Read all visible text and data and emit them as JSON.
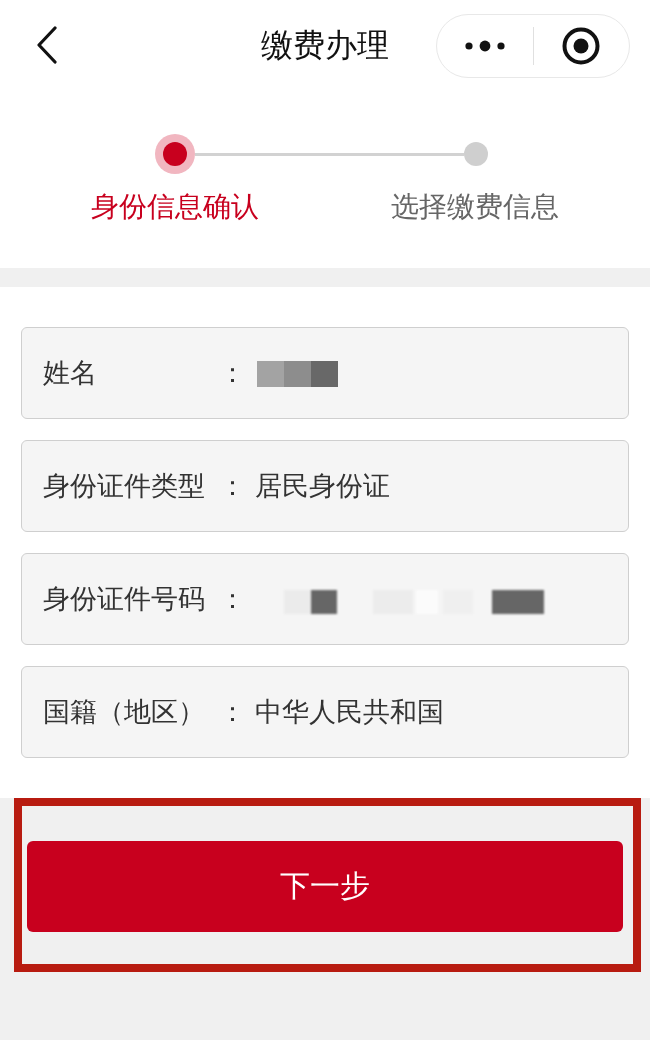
{
  "header": {
    "title": "缴费办理"
  },
  "steps": [
    {
      "label": "身份信息确认",
      "selected": true
    },
    {
      "label": "选择缴费信息",
      "selected": false
    }
  ],
  "fields": [
    {
      "label": "姓名",
      "separator": "：",
      "kind": "pixelated"
    },
    {
      "label": "身份证件类型",
      "separator": "：",
      "kind": "text",
      "value": "居民身份证"
    },
    {
      "label": "身份证件号码",
      "separator": "：",
      "kind": "blurred"
    },
    {
      "label": "国籍（地区）",
      "separator": "：",
      "kind": "text",
      "value": "中华人民共和国"
    }
  ],
  "footer": {
    "button": "下一步",
    "highlighted": true
  }
}
